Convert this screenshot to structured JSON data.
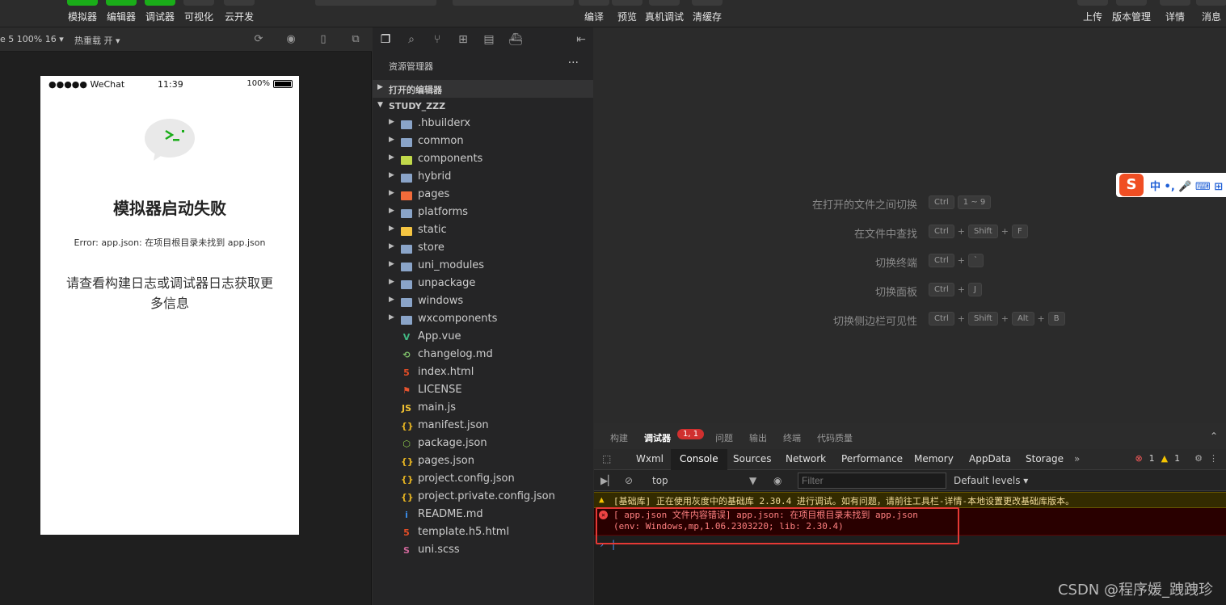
{
  "toolbar": {
    "left_buttons": [
      "模拟器",
      "编辑器",
      "调试器",
      "可视化",
      "云开发"
    ],
    "center_buttons": [
      "编译",
      "预览",
      "真机调试",
      "清缓存"
    ],
    "right_buttons": [
      "上传",
      "版本管理",
      "详情",
      "消息"
    ]
  },
  "simulator": {
    "device_label": "e 5 100% 16 ▾",
    "hot_reload": "热重载 开 ▾",
    "status": {
      "carrier": "●●●●● WeChat",
      "time": "11:39",
      "battery": "100%"
    },
    "title": "模拟器启动失败",
    "error": "Error: app.json: 在项目根目录未找到 app.json",
    "message": "请查看构建日志或调试器日志获取更多信息"
  },
  "explorer": {
    "title": "资源管理器",
    "more": "···",
    "open_editors": "打开的编辑器",
    "project": "STUDY_ZZZ",
    "items": [
      {
        "name": ".hbuilderx",
        "type": "folder",
        "icon": "folder-icon",
        "color": "#8aa4c8"
      },
      {
        "name": "common",
        "type": "folder",
        "icon": "folder-icon",
        "color": "#8aa4c8"
      },
      {
        "name": "components",
        "type": "folder",
        "icon": "components-folder-icon",
        "color": "#c0d84a"
      },
      {
        "name": "hybrid",
        "type": "folder",
        "icon": "folder-icon",
        "color": "#8aa4c8"
      },
      {
        "name": "pages",
        "type": "folder",
        "icon": "pages-folder-icon",
        "color": "#f26b3a"
      },
      {
        "name": "platforms",
        "type": "folder",
        "icon": "folder-icon",
        "color": "#8aa4c8"
      },
      {
        "name": "static",
        "type": "folder",
        "icon": "static-folder-icon",
        "color": "#f5c542"
      },
      {
        "name": "store",
        "type": "folder",
        "icon": "folder-icon",
        "color": "#8aa4c8"
      },
      {
        "name": "uni_modules",
        "type": "folder",
        "icon": "folder-icon",
        "color": "#8aa4c8"
      },
      {
        "name": "unpackage",
        "type": "folder",
        "icon": "folder-icon",
        "color": "#8aa4c8"
      },
      {
        "name": "windows",
        "type": "folder",
        "icon": "folder-icon",
        "color": "#8aa4c8"
      },
      {
        "name": "wxcomponents",
        "type": "folder",
        "icon": "folder-icon",
        "color": "#8aa4c8"
      },
      {
        "name": "App.vue",
        "type": "file",
        "icon": "vue-icon",
        "glyph": "V",
        "color": "#41b883"
      },
      {
        "name": "changelog.md",
        "type": "file",
        "icon": "history-icon",
        "glyph": "⟲",
        "color": "#7fc06a"
      },
      {
        "name": "index.html",
        "type": "file",
        "icon": "html-icon",
        "glyph": "5",
        "color": "#e44d26"
      },
      {
        "name": "LICENSE",
        "type": "file",
        "icon": "license-icon",
        "glyph": "⚑",
        "color": "#e8542f"
      },
      {
        "name": "main.js",
        "type": "file",
        "icon": "js-icon",
        "glyph": "JS",
        "color": "#f1c232"
      },
      {
        "name": "manifest.json",
        "type": "file",
        "icon": "json-icon",
        "glyph": "{}",
        "color": "#e6b422"
      },
      {
        "name": "package.json",
        "type": "file",
        "icon": "node-icon",
        "glyph": "⬡",
        "color": "#8cc84b"
      },
      {
        "name": "pages.json",
        "type": "file",
        "icon": "json-icon",
        "glyph": "{}",
        "color": "#e6b422"
      },
      {
        "name": "project.config.json",
        "type": "file",
        "icon": "json-icon",
        "glyph": "{}",
        "color": "#e6b422"
      },
      {
        "name": "project.private.config.json",
        "type": "file",
        "icon": "json-icon",
        "glyph": "{}",
        "color": "#e6b422"
      },
      {
        "name": "README.md",
        "type": "file",
        "icon": "info-icon",
        "glyph": "i",
        "color": "#3b8eea"
      },
      {
        "name": "template.h5.html",
        "type": "file",
        "icon": "html-icon",
        "glyph": "5",
        "color": "#e44d26"
      },
      {
        "name": "uni.scss",
        "type": "file",
        "icon": "sass-icon",
        "glyph": "S",
        "color": "#cd6799"
      }
    ]
  },
  "editor": {
    "hints": [
      {
        "label": "在打开的文件之间切换",
        "keys": [
          "Ctrl",
          "1 ~ 9"
        ],
        "joins": [
          ""
        ]
      },
      {
        "label": "在文件中查找",
        "keys": [
          "Ctrl",
          "Shift",
          "F"
        ],
        "joins": [
          "+",
          "+"
        ]
      },
      {
        "label": "切换终端",
        "keys": [
          "Ctrl",
          "`"
        ],
        "joins": [
          "+"
        ]
      },
      {
        "label": "切换面板",
        "keys": [
          "Ctrl",
          "J"
        ],
        "joins": [
          "+"
        ]
      },
      {
        "label": "切换侧边栏可见性",
        "keys": [
          "Ctrl",
          "Shift",
          "Alt",
          "B"
        ],
        "joins": [
          "+",
          "+",
          "+"
        ]
      }
    ],
    "ime": {
      "logo": "S",
      "text": "中 •, 🎤 ⌨ ⊞"
    }
  },
  "panel": {
    "tabs": [
      "构建",
      "调试器",
      "问题",
      "输出",
      "终端",
      "代码质量"
    ],
    "badge": "1, 1",
    "devtools_tabs": [
      "Wxml",
      "Console",
      "Sources",
      "Network",
      "Performance",
      "Memory",
      "AppData",
      "Storage"
    ],
    "more": "»",
    "error_count": "1",
    "warning_count": "1",
    "context": "top",
    "filter_placeholder": "Filter",
    "levels": "Default levels ▾",
    "warning_text": "[基础库] 正在使用灰度中的基础库 2.30.4 进行调试。如有问题，请前往工具栏-详情-本地设置更改基础库版本。",
    "error_line1": "[ app.json 文件内容错误] app.json: 在项目根目录未找到 app.json",
    "error_line2": "(env: Windows,mp,1.06.2303220; lib: 2.30.4)",
    "prompt": "› |"
  },
  "watermark": "CSDN @程序媛_跩跩珍"
}
